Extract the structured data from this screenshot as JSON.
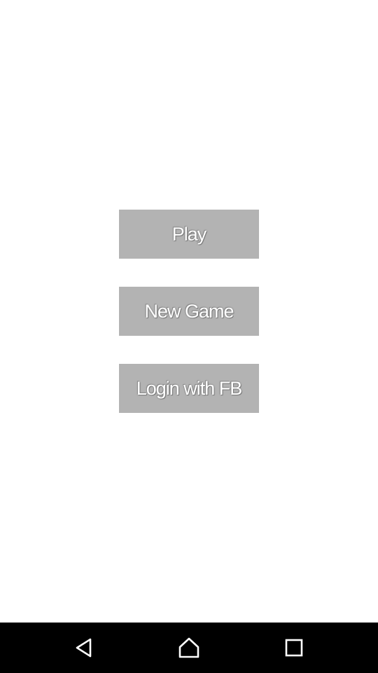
{
  "menu": {
    "play_label": "Play",
    "new_game_label": "New Game",
    "login_fb_label": "Login with FB"
  },
  "navigation_bar": {
    "buttons": [
      {
        "icon": "back-icon"
      },
      {
        "icon": "home-icon"
      },
      {
        "icon": "recents-icon"
      }
    ],
    "colors": {
      "bar": "#000000",
      "icon": "#ffffff"
    }
  },
  "colors": {
    "background": "#ffffff",
    "button_fill": "#b3b3b3",
    "button_text": "#ffffff"
  }
}
